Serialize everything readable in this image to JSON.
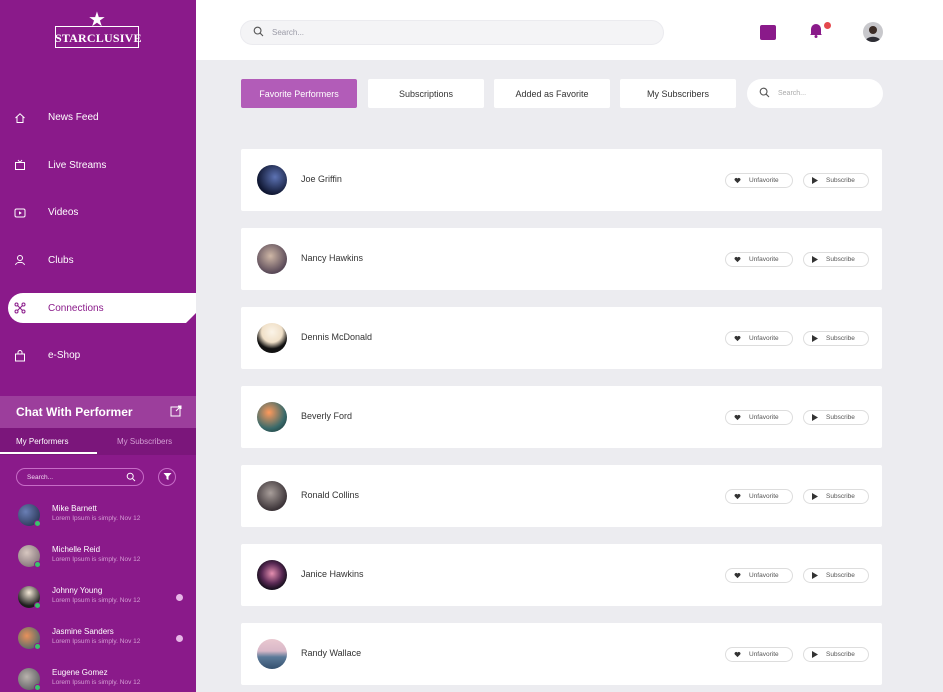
{
  "brand": {
    "name": "STARCLUSIVE"
  },
  "nav": [
    {
      "label": "News Feed",
      "icon": "home-icon"
    },
    {
      "label": "Live Streams",
      "icon": "live-stream-icon"
    },
    {
      "label": "Videos",
      "icon": "video-icon"
    },
    {
      "label": "Clubs",
      "icon": "clubs-icon"
    },
    {
      "label": "Connections",
      "icon": "connections-icon",
      "active": true
    },
    {
      "label": "e-Shop",
      "icon": "shop-icon"
    }
  ],
  "chat": {
    "title": "Chat With Performer",
    "tabs": [
      "My Performers",
      "My Subscribers"
    ],
    "search_placeholder": "Search...",
    "items": [
      {
        "name": "Mike Barnett",
        "message": "Lorem Ipsum is simply.",
        "date": "Nov 12",
        "unread": false
      },
      {
        "name": "Michelle Reid",
        "message": "Lorem Ipsum is simply.",
        "date": "Nov 12",
        "unread": false
      },
      {
        "name": "Johnny Young",
        "message": "Lorem Ipsum is simply.",
        "date": "Nov 12",
        "unread": true
      },
      {
        "name": "Jasmine Sanders",
        "message": "Lorem Ipsum is simply.",
        "date": "Nov 12",
        "unread": true
      },
      {
        "name": "Eugene Gomez",
        "message": "Lorem Ipsum is simply.",
        "date": "Nov 12",
        "unread": false
      }
    ]
  },
  "topbar": {
    "search_placeholder": "Search..."
  },
  "tabs": {
    "items": [
      "Favorite Performers",
      "Subscriptions",
      "Added as Favorite",
      "My Subscribers"
    ],
    "active": "Favorite Performers",
    "search_placeholder": "Search..."
  },
  "performers": [
    {
      "name": "Joe Griffin"
    },
    {
      "name": "Nancy Hawkins"
    },
    {
      "name": "Dennis McDonald"
    },
    {
      "name": "Beverly Ford"
    },
    {
      "name": "Ronald Collins"
    },
    {
      "name": "Janice Hawkins"
    },
    {
      "name": "Randy Wallace"
    }
  ],
  "actions": {
    "unfavorite": "Unfavorite",
    "subscribe": "Subscribe"
  },
  "colors": {
    "brand": "#8a1a8a",
    "active_tab": "#b25cb8",
    "online": "#3cc26b",
    "alert": "#e5484d"
  }
}
